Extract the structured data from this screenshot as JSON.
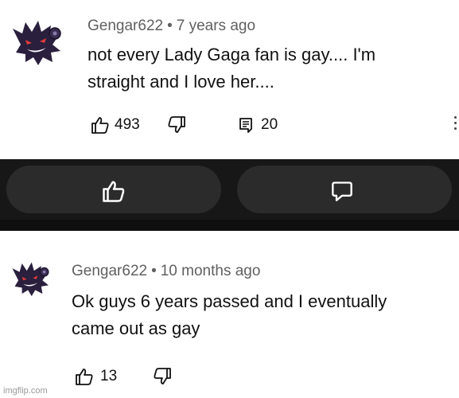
{
  "comments": [
    {
      "author": "Gengar622",
      "separator": "•",
      "time": "7 years ago",
      "text_line1": "not every Lady Gaga fan is gay.... I'm",
      "text_line2": "straight and I love her....",
      "likes": "493",
      "replies": "20"
    },
    {
      "author": "Gengar622",
      "separator": "•",
      "time": "10 months ago",
      "text_line1": "Ok guys 6 years passed and I eventually",
      "text_line2": "came out as gay",
      "likes": "13"
    }
  ],
  "icons": {
    "like": "thumbs-up-icon",
    "dislike": "thumbs-down-icon",
    "reply": "reply-icon",
    "comment": "comment-bubble-icon",
    "more": "more-vertical-icon"
  },
  "colors": {
    "band": "#171717",
    "pill": "#2b2b2b",
    "avatar": "#2a1f3d"
  },
  "watermark": "imgflip.com"
}
